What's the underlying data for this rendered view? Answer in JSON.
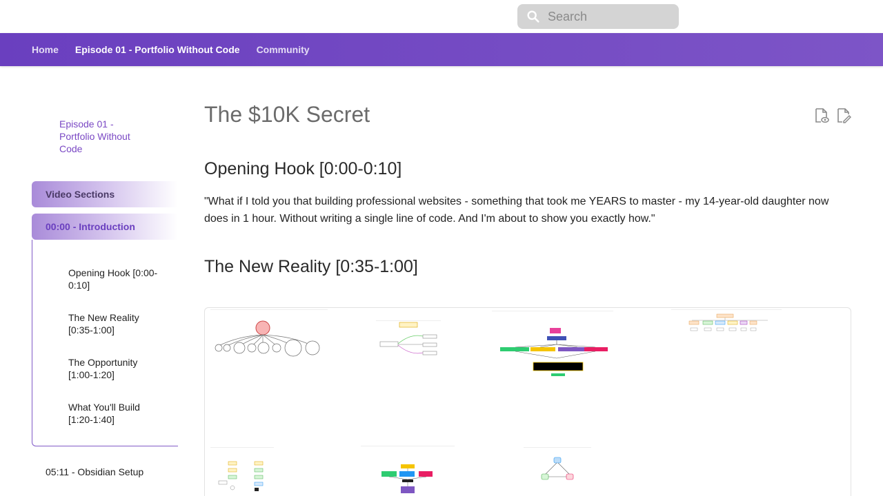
{
  "search": {
    "placeholder": "Search"
  },
  "nav": {
    "items": [
      {
        "label": "Home"
      },
      {
        "label": "Episode 01 - Portfolio Without Code"
      },
      {
        "label": "Community"
      }
    ]
  },
  "sidebar": {
    "episode": "Episode 01 - Portfolio Without Code",
    "video_sections": "Video Sections",
    "introduction": "00:00 - Introduction",
    "items": [
      {
        "label": "Opening Hook [0:00-0:10]"
      },
      {
        "label": "The New Reality [0:35-1:00]"
      },
      {
        "label": "The Opportunity [1:00-1:20]"
      },
      {
        "label": "What You'll Build [1:20-1:40]"
      }
    ],
    "obsidian": "05:11 - Obsidian Setup"
  },
  "page": {
    "title": "The $10K Secret",
    "sections": [
      {
        "heading": "Opening Hook [0:00-0:10]"
      },
      {
        "heading": "The New Reality [0:35-1:00]"
      }
    ],
    "quote": "\"What if I told you that building professional websites - something that took me YEARS to master - my 14-year-old daughter now does in 1 hour. Without writing a single line of code. And I'm about to show you exactly how.\""
  },
  "colors": {
    "nav_start": "#6a3fbf",
    "nav_end": "#7d55c7",
    "accent": "#7a48c4",
    "search_bg": "#d4d4d4"
  },
  "icons": [
    "search-icon",
    "reading-view-icon",
    "edit-file-icon"
  ],
  "gallery": {
    "thumbnails": [
      {
        "name": "mind-map-circles-thumbnail"
      },
      {
        "name": "branching-flow-thumbnail"
      },
      {
        "name": "colored-process-flow-thumbnail"
      },
      {
        "name": "org-tree-thumbnail"
      },
      {
        "name": "yellow-green-diagram-thumbnail"
      },
      {
        "name": "colored-block-diagram-thumbnail"
      },
      {
        "name": "triangle-diagram-thumbnail"
      }
    ]
  }
}
